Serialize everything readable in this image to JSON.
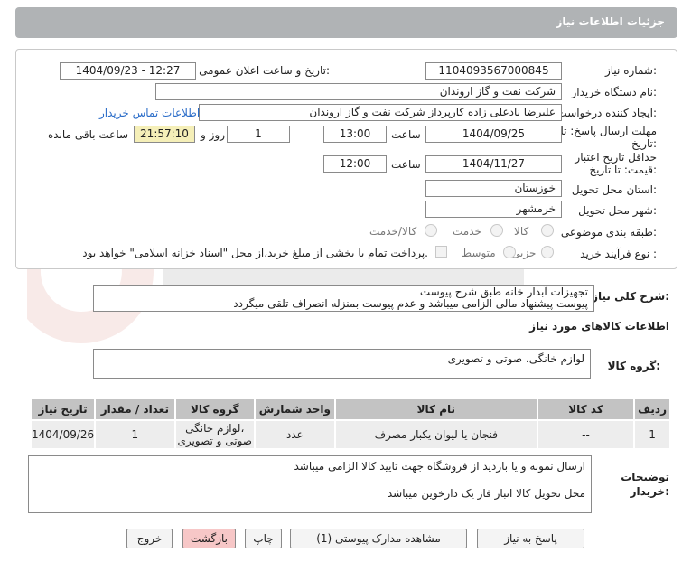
{
  "header": {
    "title": "جزئیات اطلاعات نیاز"
  },
  "form": {
    "need_number": {
      "label": "شماره نیاز:",
      "value": "1104093567000845"
    },
    "announce_datetime": {
      "label": "تاریخ و ساعت اعلان عمومی:",
      "value": "1404/09/23 - 12:27"
    },
    "buyer_org": {
      "label": "نام دستگاه خریدار:",
      "value": "شرکت نفت و گاز اروندان"
    },
    "requester": {
      "label": "ایجاد کننده درخواست:",
      "value": "علیرضا نادعلی زاده کارپرداز شرکت نفت و گاز اروندان",
      "contact_link": "اطلاعات تماس خریدار"
    },
    "deadline": {
      "label_line1": "مهلت ارسال پاسخ: تا",
      "label_line2": "تاریخ:",
      "date": "1404/09/25",
      "time_label": "ساعت",
      "time": "13:00",
      "days": "1",
      "days_label": "روز و",
      "remaining": "21:57:10",
      "remaining_label": "ساعت باقی مانده"
    },
    "validity": {
      "label_line1": "حداقل تاریخ اعتبار",
      "label_line2": "قیمت: تا تاریخ:",
      "date": "1404/11/27",
      "time_label": "ساعت",
      "time": "12:00"
    },
    "province": {
      "label": "استان محل تحویل:",
      "value": "خوزستان"
    },
    "city": {
      "label": "شهر محل تحویل:",
      "value": "خرمشهر"
    },
    "category": {
      "label": "طبقه بندی موضوعی:",
      "options": [
        "کالا",
        "خدمت",
        "کالا/خدمت"
      ]
    },
    "purchase_type": {
      "label": "نوع فرآیند خرید :",
      "options": [
        "جزیی",
        "متوسط"
      ],
      "payment_note": "پرداخت تمام یا بخشی از مبلغ خرید،از محل \"اسناد خزانه اسلامی\" خواهد بود."
    }
  },
  "description": {
    "label": "شرح کلی نیاز:",
    "line1": "تجهیزات آبدار خانه طبق شرح پیوست",
    "line2": "پیوست پیشنهاد مالی الزامی میباشد و عدم پیوست بمنزله انصراف تلقی میگردد"
  },
  "goods_section": {
    "title": "اطلاعات کالاهای مورد نیاز"
  },
  "goods_group": {
    "label": "گروه کالا:",
    "value": "لوازم خانگی، صوتی و تصویری"
  },
  "table": {
    "headers": [
      "ردیف",
      "کد کالا",
      "نام کالا",
      "واحد شمارش",
      "گروه کالا",
      "تعداد / مقدار",
      "تاریخ نیاز"
    ],
    "rows": [
      {
        "index": "1",
        "code": "--",
        "name": "فنجان یا لیوان یکبار مصرف",
        "unit": "عدد",
        "group_line1": "لوازم خانگی،",
        "group_line2": "صوتی و تصویری",
        "qty": "1",
        "date": "1404/09/26"
      }
    ]
  },
  "buyer_notes": {
    "label_line1": "توضیحات",
    "label_line2": "خریدار:",
    "line1": "ارسال نمونه و یا بازدید از فروشگاه جهت تایید کالا الزامی میباشد",
    "line2": "محل تحویل کالا انبار فاز یک دارخوین میباشد"
  },
  "buttons": {
    "reply": "پاسخ به نیاز",
    "attachments": "مشاهده مدارک پیوستی (1)",
    "print": "چاپ",
    "back": "بازگشت",
    "exit": "خروج"
  },
  "colors": {
    "title_bar": "#b0b3b5",
    "remaining_time_bg": "#f5efb8",
    "back_button_bg": "#f7c7c7",
    "table_header_bg": "#c3c3c3"
  }
}
